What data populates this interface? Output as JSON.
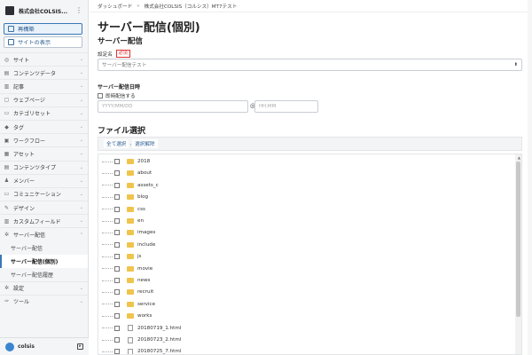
{
  "sidebar": {
    "site_name": "株式会社COLSIS...",
    "rebuild_label": "再構築",
    "view_site_label": "サイトの表示",
    "items": [
      {
        "label": "サイト",
        "icon": "world-icon"
      },
      {
        "label": "コンテンツデータ",
        "icon": "database-icon"
      },
      {
        "label": "記事",
        "icon": "document-icon"
      },
      {
        "label": "ウェブページ",
        "icon": "page-icon"
      },
      {
        "label": "カテゴリセット",
        "icon": "folder-icon"
      },
      {
        "label": "タグ",
        "icon": "tag-icon"
      },
      {
        "label": "ワークフロー",
        "icon": "workflow-icon"
      },
      {
        "label": "アセット",
        "icon": "asset-icon"
      },
      {
        "label": "コンテンツタイプ",
        "icon": "content-type-icon"
      },
      {
        "label": "メンバー",
        "icon": "user-icon"
      },
      {
        "label": "コミュニケーション",
        "icon": "chat-icon"
      },
      {
        "label": "デザイン",
        "icon": "palette-icon"
      },
      {
        "label": "カスタムフィールド",
        "icon": "custom-field-icon"
      },
      {
        "label": "サーバー配信",
        "icon": "gear-icon"
      }
    ],
    "sub_items": [
      {
        "label": "サーバー配信"
      },
      {
        "label": "サーバー配信(個別)"
      },
      {
        "label": "サーバー配信履歴"
      }
    ],
    "bottom_items": [
      {
        "label": "設定",
        "icon": "settings-icon"
      },
      {
        "label": "ツール",
        "icon": "wrench-icon"
      }
    ],
    "user_name": "colsis"
  },
  "breadcrumb": {
    "root": "ダッシュボード",
    "sep": "»",
    "current": "株式会社COLSIS（コルシス）MT7テスト"
  },
  "main": {
    "page_title": "サーバー配信(個別)",
    "section_title": "サーバー配信",
    "setting_label": "設定名",
    "required_label": "必須",
    "select_value": "サーバー配信テスト",
    "date_title": "サーバー配信日時",
    "immediate_label": "即時配信する",
    "date_placeholder": "YYYY/MM/DD",
    "time_placeholder": "HH:MM",
    "at_symbol": "@",
    "file_title": "ファイル選択",
    "select_all": "全て選択",
    "deselect": "選択解除",
    "files": [
      {
        "name": "2018",
        "type": "folder"
      },
      {
        "name": "about",
        "type": "folder"
      },
      {
        "name": "assets_c",
        "type": "folder"
      },
      {
        "name": "blog",
        "type": "folder"
      },
      {
        "name": "css",
        "type": "folder"
      },
      {
        "name": "en",
        "type": "folder"
      },
      {
        "name": "images",
        "type": "folder"
      },
      {
        "name": "include",
        "type": "folder"
      },
      {
        "name": "js",
        "type": "folder"
      },
      {
        "name": "movie",
        "type": "folder"
      },
      {
        "name": "news",
        "type": "folder"
      },
      {
        "name": "recruit",
        "type": "folder"
      },
      {
        "name": "service",
        "type": "folder"
      },
      {
        "name": "works",
        "type": "folder"
      },
      {
        "name": "20180719_1.html",
        "type": "file"
      },
      {
        "name": "20180723_2.html",
        "type": "file"
      },
      {
        "name": "20180725_7.html",
        "type": "file"
      }
    ]
  },
  "colors": {
    "accent": "#3a78b8",
    "folder": "#f0c44c",
    "required": "#dd3333"
  }
}
